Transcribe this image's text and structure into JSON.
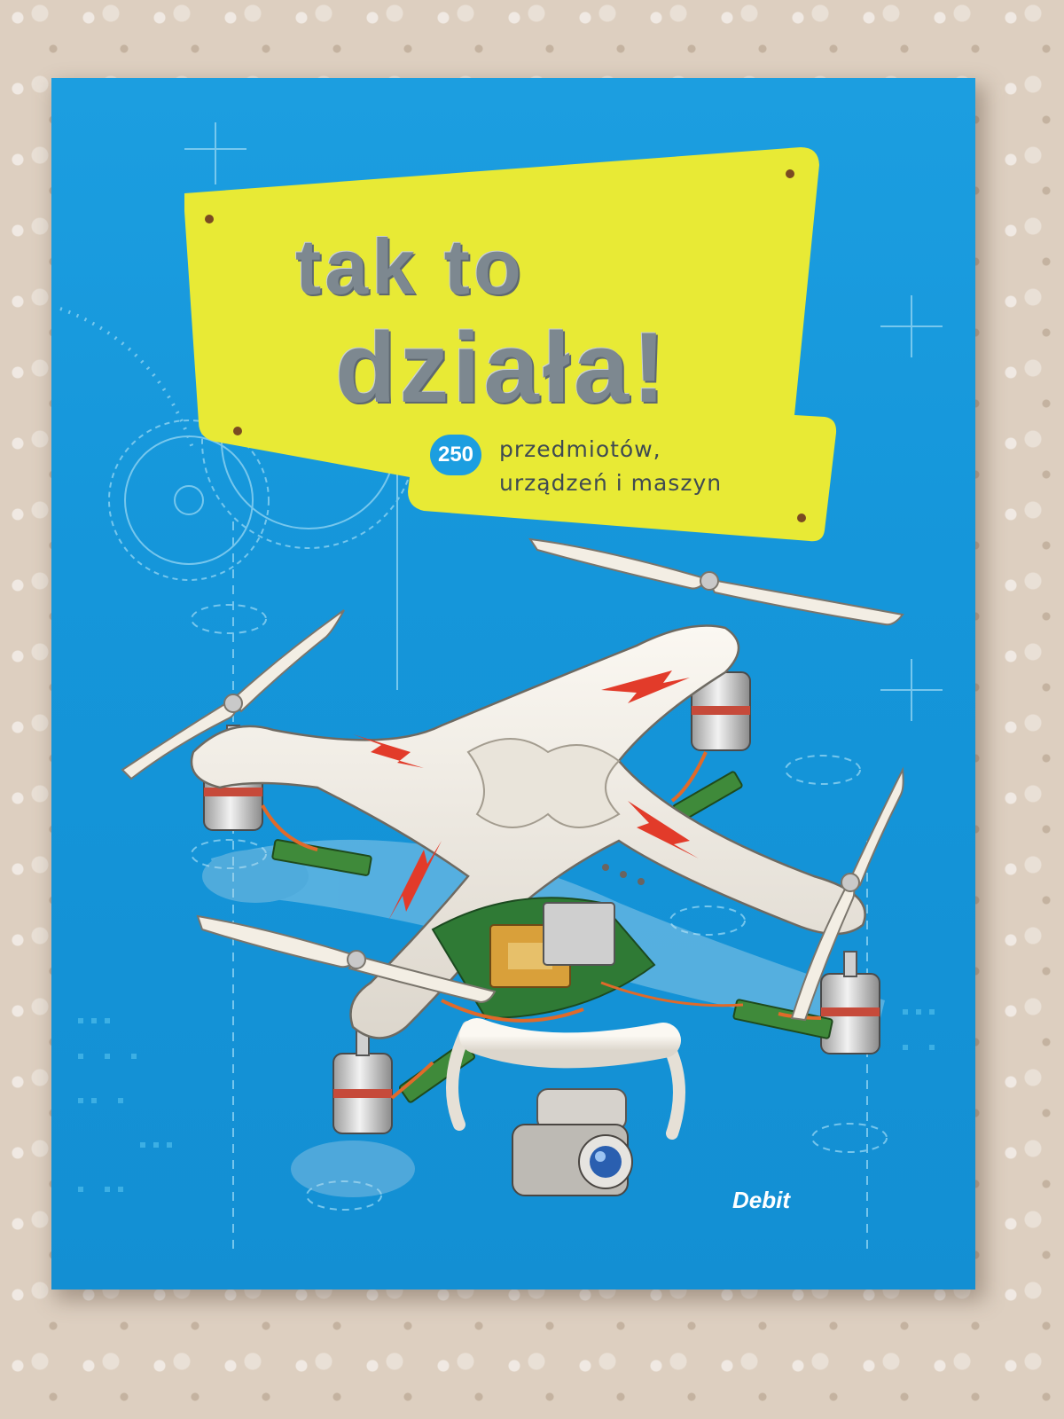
{
  "cover": {
    "title_line1": "tak to",
    "title_line2": "działa!",
    "count": "250",
    "subtitle_line1": "przedmiotów,",
    "subtitle_line2": "urządzeń i maszyn",
    "publisher": "Debit"
  },
  "colors": {
    "cover_blue": "#1596da",
    "banner_yellow": "#e8ea35",
    "title_grey": "#7d8890",
    "background_fabric": "#ddcfc0"
  },
  "illustration": {
    "subject": "quadcopter-drone",
    "icon": "drone-icon"
  }
}
